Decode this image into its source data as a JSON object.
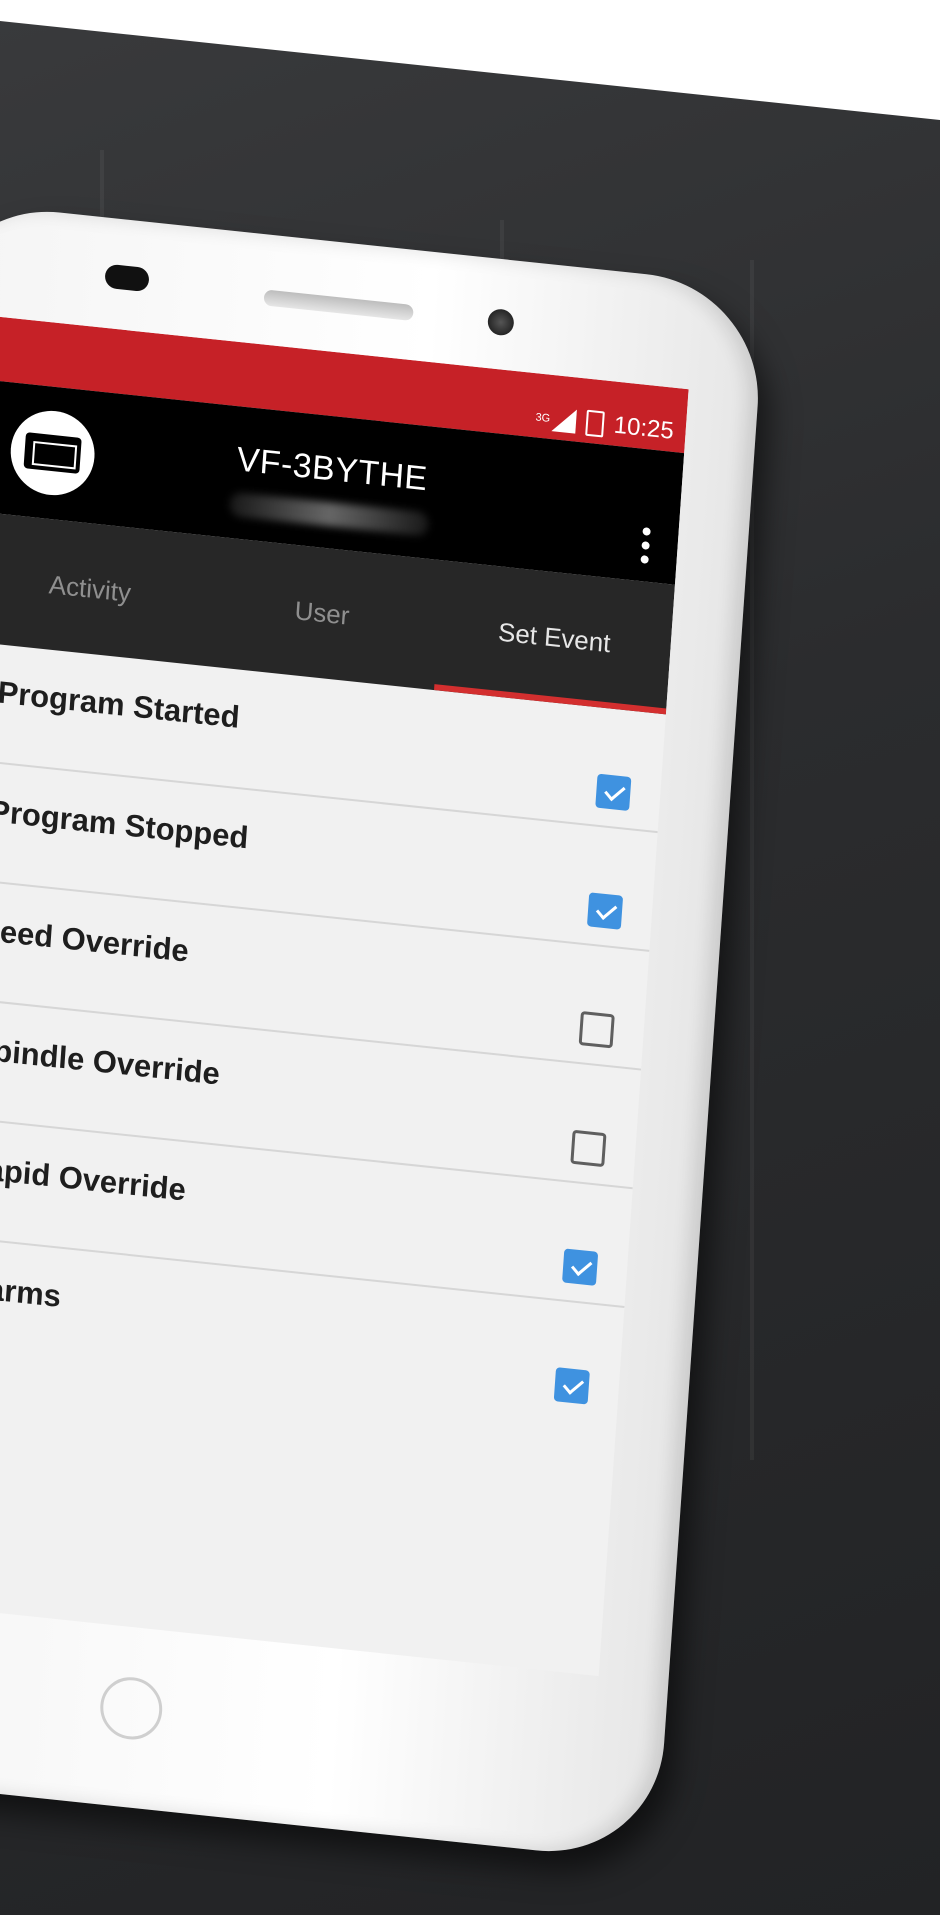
{
  "status_bar": {
    "network": "3G",
    "time": "10:25"
  },
  "app_bar": {
    "title": "VF-3BYTHE"
  },
  "tabs": [
    {
      "label": "Activity",
      "active": false
    },
    {
      "label": "User",
      "active": false
    },
    {
      "label": "Set Event",
      "active": true
    }
  ],
  "events": [
    {
      "label": "Program Started",
      "checked": true
    },
    {
      "label": "Program Stopped",
      "checked": true
    },
    {
      "label": "Feed Override",
      "checked": false
    },
    {
      "label": "Spindle Override",
      "checked": false
    },
    {
      "label": "Rapid Override",
      "checked": true
    },
    {
      "label": "Alarms",
      "checked": true
    }
  ],
  "colors": {
    "status_bar": "#c62127",
    "app_bar": "#000000",
    "tab_bar": "#272727",
    "tab_indicator": "#d32f2f",
    "checkbox_checked": "#3f92e0"
  }
}
